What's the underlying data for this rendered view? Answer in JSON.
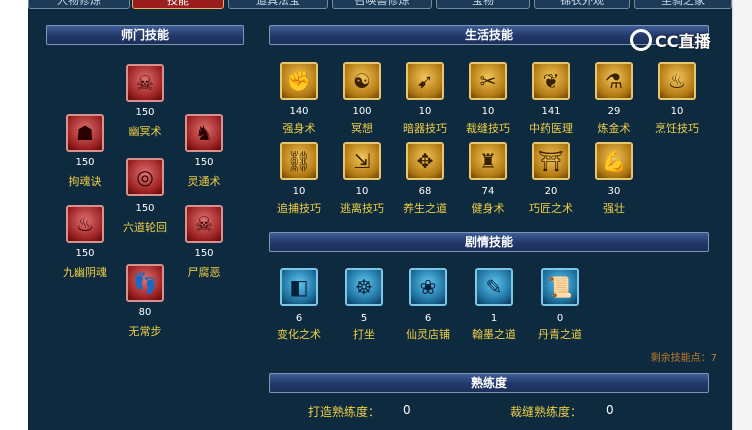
{
  "tabs": [
    {
      "label": "人物修炼"
    },
    {
      "label": "技能"
    },
    {
      "label": "道具法宝"
    },
    {
      "label": "召唤兽修炼"
    },
    {
      "label": "宝物"
    },
    {
      "label": "锦衣外观"
    },
    {
      "label": "坐骑之家"
    }
  ],
  "sections": {
    "school": "师门技能",
    "life": "生活技能",
    "story": "剧情技能",
    "proficiency": "熟练度"
  },
  "school_skills": [
    {
      "name": "幽冥术",
      "level": "150",
      "icon": "ghost-icon"
    },
    {
      "name": "拘魂诀",
      "level": "150",
      "icon": "cage-face-icon"
    },
    {
      "name": "灵通术",
      "level": "150",
      "icon": "gorilla-icon"
    },
    {
      "name": "六道轮回",
      "level": "150",
      "icon": "wheel-icon"
    },
    {
      "name": "九幽阴魂",
      "level": "150",
      "icon": "wraith-icon"
    },
    {
      "name": "尸腐恶",
      "level": "150",
      "icon": "skull-icon"
    },
    {
      "name": "无常步",
      "level": "80",
      "icon": "footstep-icon"
    }
  ],
  "life_skills": [
    {
      "name": "强身术",
      "level": "140",
      "icon": "fist-icon"
    },
    {
      "name": "冥想",
      "level": "100",
      "icon": "meditate-icon"
    },
    {
      "name": "暗器技巧",
      "level": "10",
      "icon": "dart-icon"
    },
    {
      "name": "裁缝技巧",
      "level": "10",
      "icon": "scissors-icon"
    },
    {
      "name": "中药医理",
      "level": "141",
      "icon": "herb-icon"
    },
    {
      "name": "炼金术",
      "level": "29",
      "icon": "alchemy-icon"
    },
    {
      "name": "烹饪技巧",
      "level": "10",
      "icon": "cooking-icon"
    },
    {
      "name": "追捕技巧",
      "level": "10",
      "icon": "chain-icon"
    },
    {
      "name": "逃离技巧",
      "level": "10",
      "icon": "escape-icon"
    },
    {
      "name": "养生之道",
      "level": "68",
      "icon": "health-icon"
    },
    {
      "name": "健身术",
      "level": "74",
      "icon": "fitness-icon"
    },
    {
      "name": "巧匠之术",
      "level": "20",
      "icon": "craftsman-icon"
    },
    {
      "name": "强壮",
      "level": "30",
      "icon": "muscle-icon"
    }
  ],
  "story_skills": [
    {
      "name": "变化之术",
      "level": "6",
      "icon": "transform-icon"
    },
    {
      "name": "打坐",
      "level": "5",
      "icon": "sit-icon"
    },
    {
      "name": "仙灵店铺",
      "level": "6",
      "icon": "shop-icon"
    },
    {
      "name": "翰墨之道",
      "level": "1",
      "icon": "ink-icon"
    },
    {
      "name": "丹青之道",
      "level": "0",
      "icon": "scroll-icon"
    }
  ],
  "remaining_points": "剩余技能点：7",
  "proficiency": [
    {
      "label": "打造熟练度：",
      "value": "0"
    },
    {
      "label": "裁缝熟练度：",
      "value": "0"
    }
  ],
  "watermark": "CC直播"
}
